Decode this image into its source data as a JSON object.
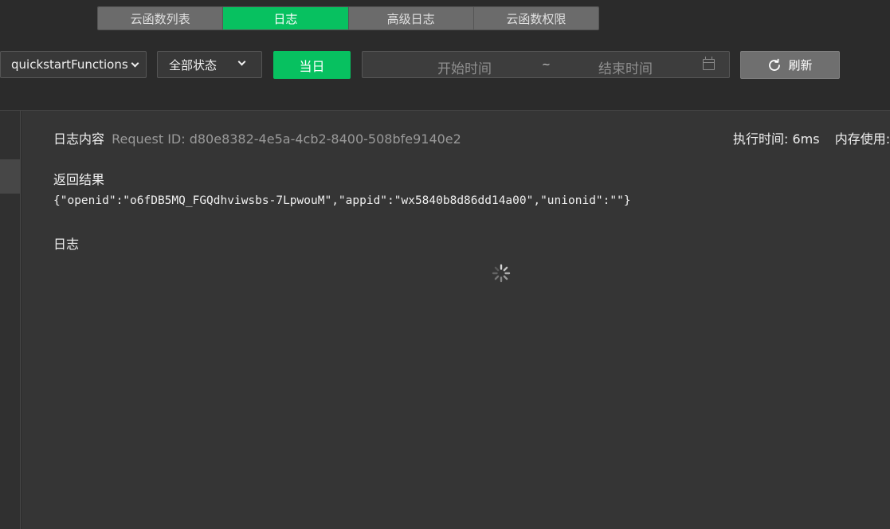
{
  "tabs": [
    {
      "label": "云函数列表"
    },
    {
      "label": "日志"
    },
    {
      "label": "高级日志"
    },
    {
      "label": "云函数权限"
    }
  ],
  "toolbar": {
    "function_select": "quickstartFunctions",
    "status_select": "全部状态",
    "today_label": "当日",
    "start_placeholder": "开始时间",
    "separator": "~",
    "end_placeholder": "结束时间",
    "refresh_label": "刷新"
  },
  "log": {
    "content_label": "日志内容",
    "request_id_label": "Request ID: d80e8382-4e5a-4cb2-8400-508bfe9140e2",
    "exec_time": "执行时间: 6ms",
    "memory": "内存使用:",
    "result_title": "返回结果",
    "result_json": "{\"openid\":\"o6fDB5MQ_FGQdhviwsbs-7LpwouM\",\"appid\":\"wx5840b8d86dd14a00\",\"unionid\":\"\"}",
    "log_title": "日志"
  },
  "colors": {
    "accent": "#07c160",
    "background": "#2b2b2b",
    "panel": "#353535"
  },
  "icons": [
    "chevron-down-icon",
    "calendar-icon",
    "refresh-icon",
    "loading-spinner-icon"
  ]
}
